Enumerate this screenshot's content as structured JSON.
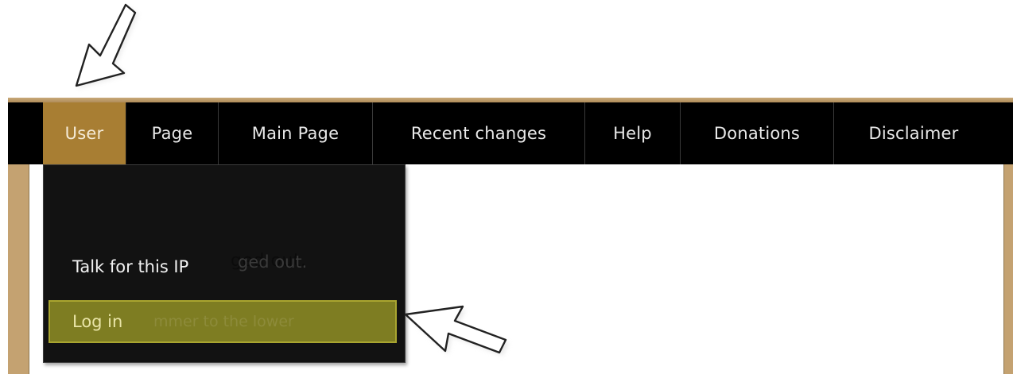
{
  "nav": {
    "items": [
      {
        "label": "User",
        "active": true
      },
      {
        "label": "Page",
        "active": false
      },
      {
        "label": "Main Page",
        "active": false
      },
      {
        "label": "Recent changes",
        "active": false
      },
      {
        "label": "Help",
        "active": false
      },
      {
        "label": "Donations",
        "active": false
      },
      {
        "label": "Disclaimer",
        "active": false
      }
    ]
  },
  "user_menu": {
    "items": [
      {
        "label": "Talk for this IP",
        "highlighted": false
      },
      {
        "label": "Log in",
        "highlighted": true
      }
    ]
  },
  "content": {
    "partial_text_1": "ged out.",
    "partial_text_2": "mmer to the lower"
  },
  "colors": {
    "nav_background": "#000000",
    "nav_active": "#a87e33",
    "menu_background": "#080808",
    "menu_highlight": "#7e7d22",
    "frame": "#c4a271"
  },
  "annotations": {
    "top_arrow": "cursor-arrow-icon",
    "side_arrow": "cursor-arrow-icon"
  }
}
